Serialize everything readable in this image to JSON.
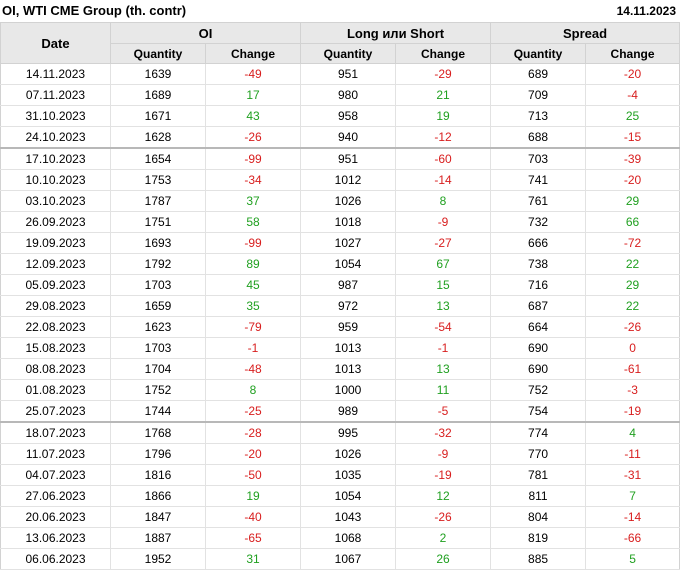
{
  "header": {
    "title": "OI, WTI CME Group (th. contr)",
    "date": "14.11.2023"
  },
  "columns": {
    "date": "Date",
    "groups": [
      "OI",
      "Long или Short",
      "Spread"
    ],
    "sub": [
      "Quantity",
      "Change",
      "Quantity",
      "Change",
      "Quantity",
      "Change"
    ]
  },
  "colors": {
    "positive": "#20a020",
    "negative": "#d81e1e"
  },
  "rows": [
    [
      "14.11.2023",
      "1639",
      "-49",
      "951",
      "-29",
      "689",
      "-20"
    ],
    [
      "07.11.2023",
      "1689",
      "17",
      "980",
      "21",
      "709",
      "-4"
    ],
    [
      "31.10.2023",
      "1671",
      "43",
      "958",
      "19",
      "713",
      "25"
    ],
    [
      "24.10.2023",
      "1628",
      "-26",
      "940",
      "-12",
      "688",
      "-15"
    ],
    [
      "17.10.2023",
      "1654",
      "-99",
      "951",
      "-60",
      "703",
      "-39"
    ],
    [
      "10.10.2023",
      "1753",
      "-34",
      "1012",
      "-14",
      "741",
      "-20"
    ],
    [
      "03.10.2023",
      "1787",
      "37",
      "1026",
      "8",
      "761",
      "29"
    ],
    [
      "26.09.2023",
      "1751",
      "58",
      "1018",
      "-9",
      "732",
      "66"
    ],
    [
      "19.09.2023",
      "1693",
      "-99",
      "1027",
      "-27",
      "666",
      "-72"
    ],
    [
      "12.09.2023",
      "1792",
      "89",
      "1054",
      "67",
      "738",
      "22"
    ],
    [
      "05.09.2023",
      "1703",
      "45",
      "987",
      "15",
      "716",
      "29"
    ],
    [
      "29.08.2023",
      "1659",
      "35",
      "972",
      "13",
      "687",
      "22"
    ],
    [
      "22.08.2023",
      "1623",
      "-79",
      "959",
      "-54",
      "664",
      "-26"
    ],
    [
      "15.08.2023",
      "1703",
      "-1",
      "1013",
      "-1",
      "690",
      "0"
    ],
    [
      "08.08.2023",
      "1704",
      "-48",
      "1013",
      "13",
      "690",
      "-61"
    ],
    [
      "01.08.2023",
      "1752",
      "8",
      "1000",
      "11",
      "752",
      "-3"
    ],
    [
      "25.07.2023",
      "1744",
      "-25",
      "989",
      "-5",
      "754",
      "-19"
    ],
    [
      "18.07.2023",
      "1768",
      "-28",
      "995",
      "-32",
      "774",
      "4"
    ],
    [
      "11.07.2023",
      "1796",
      "-20",
      "1026",
      "-9",
      "770",
      "-11"
    ],
    [
      "04.07.2023",
      "1816",
      "-50",
      "1035",
      "-19",
      "781",
      "-31"
    ],
    [
      "27.06.2023",
      "1866",
      "19",
      "1054",
      "12",
      "811",
      "7"
    ],
    [
      "20.06.2023",
      "1847",
      "-40",
      "1043",
      "-26",
      "804",
      "-14"
    ],
    [
      "13.06.2023",
      "1887",
      "-65",
      "1068",
      "2",
      "819",
      "-66"
    ],
    [
      "06.06.2023",
      "1952",
      "31",
      "1067",
      "26",
      "885",
      "5"
    ]
  ]
}
